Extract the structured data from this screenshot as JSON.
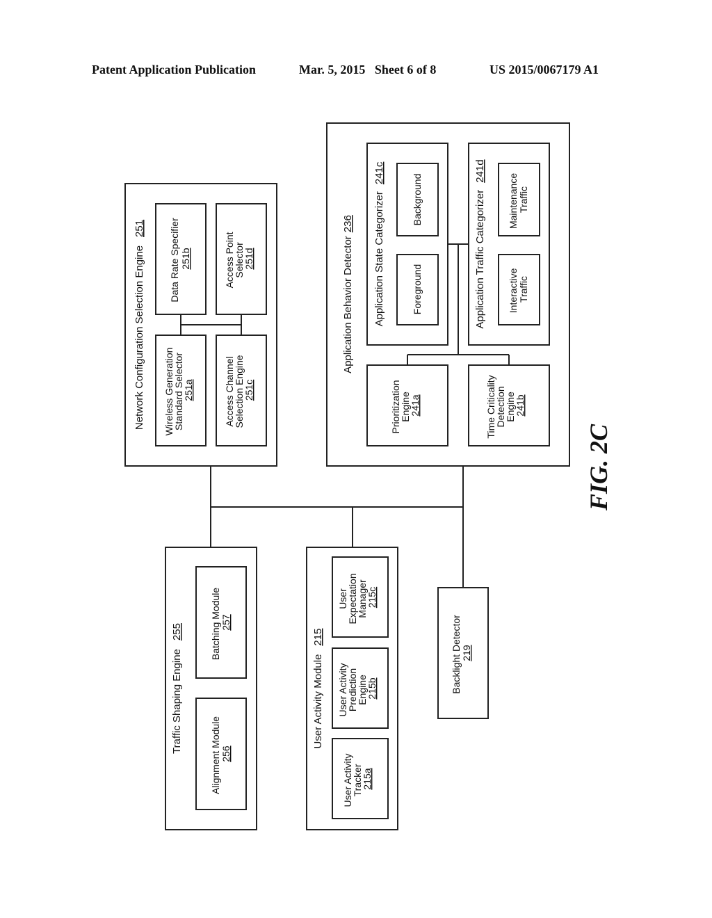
{
  "header": {
    "publication": "Patent Application Publication",
    "date_sheet": "Mar. 5, 2015   Sheet 6 of 8",
    "patent_number": "US 2015/0067179 A1"
  },
  "figure_label": "FIG. 2C",
  "network_config_engine": {
    "title": "Network Configuration Selection Engine",
    "ref": "251",
    "wireless_selector": {
      "line1": "Wireless Generation",
      "line2": "Standard Selector",
      "ref": "251a"
    },
    "data_rate": {
      "line1": "Data Rate Specifier",
      "ref": "251b"
    },
    "access_channel": {
      "line1": "Access Channel",
      "line2": "Selection Engine",
      "ref": "251c"
    },
    "access_point": {
      "line1": "Access Point",
      "line2": "Selector",
      "ref": "251d"
    }
  },
  "app_behavior_detector": {
    "title": "Application Behavior Detector",
    "ref": "236",
    "state_categorizer": {
      "title": "Application State Categorizer",
      "ref": "241c",
      "foreground": "Foreground",
      "background": "Background"
    },
    "traffic_categorizer": {
      "title": "Application Traffic Categorizer",
      "ref": "241d",
      "interactive": {
        "line1": "Interactive",
        "line2": "Traffic"
      },
      "maintenance": {
        "line1": "Maintenance",
        "line2": "Traffic"
      }
    },
    "prioritization": {
      "line1": "Prioritization",
      "line2": "Engine",
      "ref": "241a"
    },
    "time_criticality": {
      "line1": "Time Criticality",
      "line2": "Detection",
      "line3": "Engine",
      "ref": "241b"
    }
  },
  "traffic_shaping_engine": {
    "title": "Traffic Shaping Engine",
    "ref": "255",
    "alignment": {
      "line1": "Alignment Module",
      "ref": "256"
    },
    "batching": {
      "line1": "Batching Module",
      "ref": "257"
    }
  },
  "user_activity_module": {
    "title": "User Activity Module",
    "ref": "215",
    "tracker": {
      "line1": "User Activity",
      "line2": "Tracker",
      "ref": "215a"
    },
    "prediction": {
      "line1": "User Activity",
      "line2": "Prediction",
      "line3": "Engine",
      "ref": "215b"
    },
    "expectation": {
      "line1": "User",
      "line2": "Expectation",
      "line3": "Manager",
      "ref": "215c"
    }
  },
  "backlight_detector": {
    "line1": "Backlight Detector",
    "ref": "219"
  }
}
